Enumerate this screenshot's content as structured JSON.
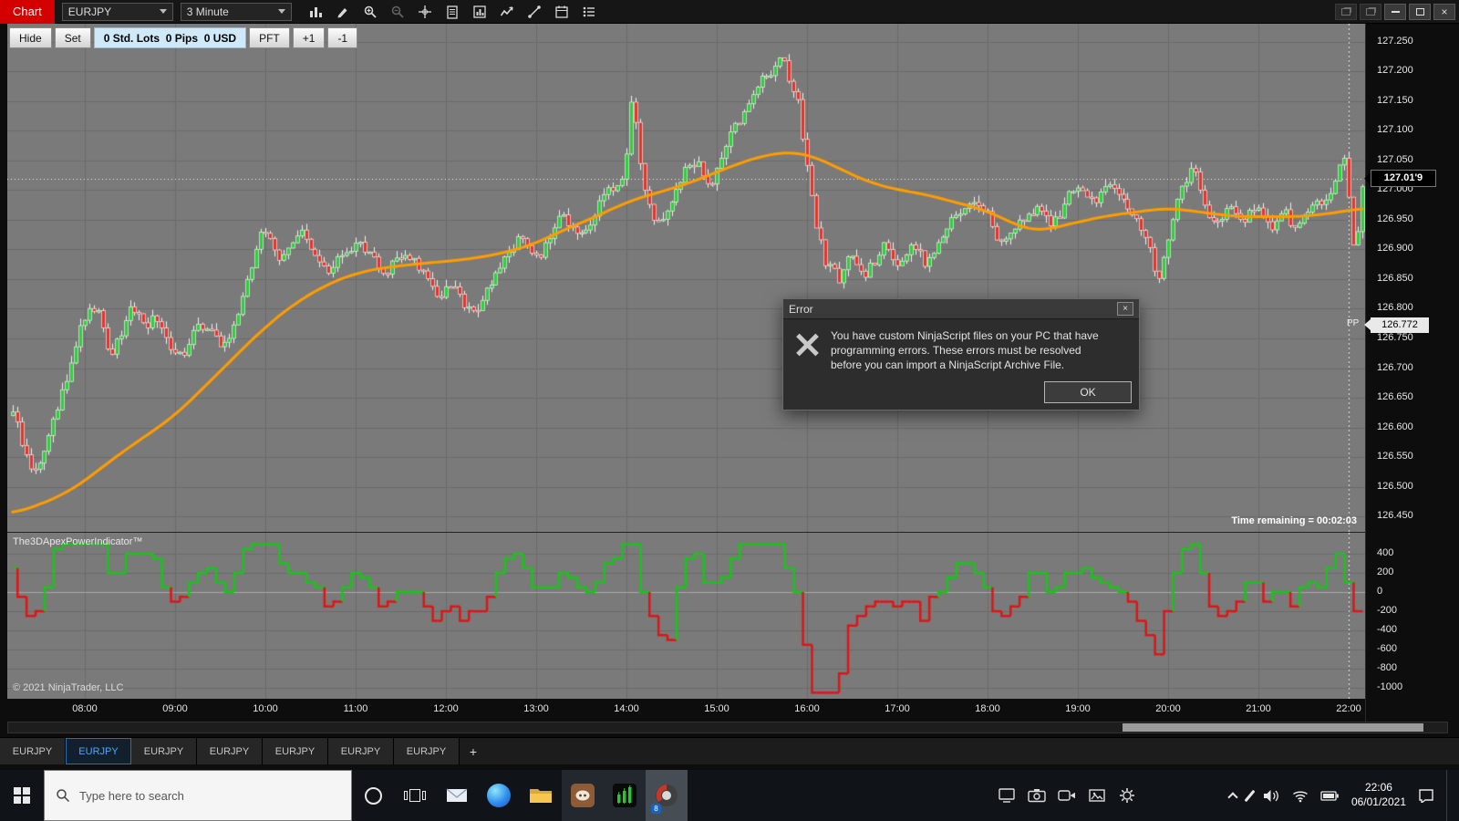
{
  "titlebar": {
    "app_label": "Chart",
    "instrument": "EURJPY",
    "period": "3 Minute",
    "toolbar_icons": [
      "chart-style-icon",
      "draw-tool-icon",
      "zoom-in-icon",
      "zoom-out-icon",
      "crosshair-icon",
      "report-icon",
      "chart-window-icon",
      "indicators-icon",
      "line-tool-icon",
      "data-series-icon",
      "properties-icon"
    ],
    "window_icons": [
      "workspace-icon",
      "workspace-icon",
      "minimize-icon",
      "maximize-icon",
      "close-icon"
    ]
  },
  "chart_trader": {
    "hide_label": "Hide",
    "set_label": "Set",
    "position_info": "0 Std. Lots  0 Pips  0 USD",
    "pft_label": "PFT",
    "plus_one_label": "+1",
    "minus_one_label": "-1"
  },
  "chart": {
    "current_price_tag": "127.01'9",
    "pivot_tag": "126.772",
    "pivot_label": "PP",
    "time_remaining": "Time remaining = 00:02:03",
    "copyright": "© 2021 NinjaTrader, LLC",
    "indicator_title": "The3DApexPowerIndicator™"
  },
  "error_dialog": {
    "title": "Error",
    "message": "You have custom NinjaScript files on your PC that have programming errors. These errors must be resolved before you can import a NinjaScript Archive File.",
    "ok_label": "OK"
  },
  "tabs": {
    "labels": [
      "EURJPY",
      "EURJPY",
      "EURJPY",
      "EURJPY",
      "EURJPY",
      "EURJPY",
      "EURJPY"
    ],
    "active_index": 1,
    "add_label": "+"
  },
  "taskbar": {
    "search_placeholder": "Type here to search",
    "clock_time": "22:06",
    "clock_date": "06/01/2021",
    "nt_badge": "8",
    "icons": [
      "start-button",
      "search-icon",
      "cortana-icon",
      "task-view-icon",
      "mail-icon",
      "edge-icon",
      "file-explorer-icon",
      "discord-icon",
      "chart-app-icon",
      "ninjatrader-icon",
      "screen-share-icon",
      "camera-icon",
      "video-camera-icon",
      "photos-icon",
      "gear-icon",
      "hidden-icons-chevron",
      "pen-icon",
      "volume-icon",
      "wifi-icon",
      "battery-icon",
      "clock",
      "notification-icon"
    ]
  },
  "chart_data": {
    "type": "candlestick",
    "instrument": "EURJPY",
    "interval_minutes": 3,
    "price_axis_labels": [
      "127.250",
      "127.200",
      "127.150",
      "127.100",
      "127.050",
      "127.000",
      "126.950",
      "126.900",
      "126.850",
      "126.800",
      "126.750",
      "126.700",
      "126.650",
      "126.600",
      "126.550",
      "126.500",
      "126.450"
    ],
    "indicator_axis_labels": [
      "400",
      "200",
      "0",
      "-200",
      "-400",
      "-600",
      "-800",
      "-1000"
    ],
    "time_axis_labels": [
      "08:00",
      "09:00",
      "10:00",
      "11:00",
      "12:00",
      "13:00",
      "14:00",
      "15:00",
      "16:00",
      "17:00",
      "18:00",
      "19:00",
      "20:00",
      "21:00",
      "22:00"
    ],
    "current_price_value": 127.019,
    "pivot_value": 126.772,
    "price_range": [
      126.45,
      127.25
    ],
    "indicator_range": [
      -1000,
      400
    ],
    "price_anchors": [
      [
        -48,
        126.63
      ],
      [
        -40,
        126.56
      ],
      [
        -34,
        126.52
      ],
      [
        -28,
        126.55
      ],
      [
        -20,
        126.62
      ],
      [
        -10,
        126.7
      ],
      [
        -4,
        126.76
      ],
      [
        2,
        126.79
      ],
      [
        8,
        126.81
      ],
      [
        16,
        126.72
      ],
      [
        24,
        126.76
      ],
      [
        31,
        126.81
      ],
      [
        40,
        126.77
      ],
      [
        47,
        126.79
      ],
      [
        56,
        126.74
      ],
      [
        65,
        126.72
      ],
      [
        74,
        126.77
      ],
      [
        83,
        126.76
      ],
      [
        92,
        126.73
      ],
      [
        100,
        126.78
      ],
      [
        108,
        126.85
      ],
      [
        114,
        126.9
      ],
      [
        119,
        126.94
      ],
      [
        125,
        126.9
      ],
      [
        131,
        126.88
      ],
      [
        138,
        126.91
      ],
      [
        144,
        126.93
      ],
      [
        152,
        126.89
      ],
      [
        162,
        126.86
      ],
      [
        170,
        126.89
      ],
      [
        183,
        126.91
      ],
      [
        192,
        126.88
      ],
      [
        201,
        126.86
      ],
      [
        208,
        126.89
      ],
      [
        216,
        126.89
      ],
      [
        226,
        126.86
      ],
      [
        235,
        126.81
      ],
      [
        241,
        126.84
      ],
      [
        247,
        126.83
      ],
      [
        253,
        126.8
      ],
      [
        259,
        126.79
      ],
      [
        266,
        126.83
      ],
      [
        274,
        126.86
      ],
      [
        281,
        126.89
      ],
      [
        289,
        126.92
      ],
      [
        295,
        126.9
      ],
      [
        301,
        126.88
      ],
      [
        308,
        126.92
      ],
      [
        316,
        126.96
      ],
      [
        324,
        126.94
      ],
      [
        332,
        126.92
      ],
      [
        338,
        126.95
      ],
      [
        344,
        126.99
      ],
      [
        350,
        127.0
      ],
      [
        356,
        127.01
      ],
      [
        360,
        127.06
      ],
      [
        363,
        127.14
      ],
      [
        366,
        127.12
      ],
      [
        368,
        127.06
      ],
      [
        372,
        127.0
      ],
      [
        377,
        126.95
      ],
      [
        382,
        126.95
      ],
      [
        386,
        126.96
      ],
      [
        392,
        127.0
      ],
      [
        398,
        127.03
      ],
      [
        403,
        127.04
      ],
      [
        407,
        127.05
      ],
      [
        412,
        127.02
      ],
      [
        416,
        127.01
      ],
      [
        420,
        127.03
      ],
      [
        424,
        127.06
      ],
      [
        428,
        127.09
      ],
      [
        433,
        127.11
      ],
      [
        437,
        127.12
      ],
      [
        442,
        127.15
      ],
      [
        447,
        127.18
      ],
      [
        451,
        127.2
      ],
      [
        456,
        127.19
      ],
      [
        459,
        127.21
      ],
      [
        462,
        127.23
      ],
      [
        465,
        127.21
      ],
      [
        468,
        127.18
      ],
      [
        471,
        127.16
      ],
      [
        474,
        127.15
      ],
      [
        477,
        127.09
      ],
      [
        480,
        127.04
      ],
      [
        483,
        126.99
      ],
      [
        486,
        126.93
      ],
      [
        489,
        126.91
      ],
      [
        492,
        126.88
      ],
      [
        496,
        126.87
      ],
      [
        501,
        126.85
      ],
      [
        506,
        126.88
      ],
      [
        510,
        126.89
      ],
      [
        515,
        126.87
      ],
      [
        519,
        126.86
      ],
      [
        525,
        126.88
      ],
      [
        531,
        126.91
      ],
      [
        536,
        126.89
      ],
      [
        540,
        126.88
      ],
      [
        545,
        126.89
      ],
      [
        550,
        126.91
      ],
      [
        555,
        126.89
      ],
      [
        559,
        126.87
      ],
      [
        564,
        126.9
      ],
      [
        568,
        126.92
      ],
      [
        574,
        126.94
      ],
      [
        580,
        126.96
      ],
      [
        585,
        126.97
      ],
      [
        589,
        126.98
      ],
      [
        594,
        126.97
      ],
      [
        598,
        126.97
      ],
      [
        601,
        126.95
      ],
      [
        604,
        126.93
      ],
      [
        607,
        126.91
      ],
      [
        610,
        126.91
      ],
      [
        613,
        126.92
      ],
      [
        616,
        126.93
      ],
      [
        620,
        126.94
      ],
      [
        625,
        126.95
      ],
      [
        629,
        126.96
      ],
      [
        634,
        126.97
      ],
      [
        639,
        126.95
      ],
      [
        643,
        126.94
      ],
      [
        648,
        126.96
      ],
      [
        653,
        126.99
      ],
      [
        658,
        127.0
      ],
      [
        662,
        127.01
      ],
      [
        666,
        126.99
      ],
      [
        671,
        126.98
      ],
      [
        675,
        127.0
      ],
      [
        680,
        127.02
      ],
      [
        684,
        127.0
      ],
      [
        689,
        126.99
      ],
      [
        694,
        126.97
      ],
      [
        698,
        126.96
      ],
      [
        702,
        126.93
      ],
      [
        707,
        126.91
      ],
      [
        710,
        126.88
      ],
      [
        713,
        126.85
      ],
      [
        716,
        126.87
      ],
      [
        719,
        126.91
      ],
      [
        723,
        126.95
      ],
      [
        728,
        127.0
      ],
      [
        733,
        127.02
      ],
      [
        737,
        127.04
      ],
      [
        740,
        127.01
      ],
      [
        743,
        126.98
      ],
      [
        747,
        126.96
      ],
      [
        752,
        126.94
      ],
      [
        757,
        126.96
      ],
      [
        761,
        126.97
      ],
      [
        766,
        126.95
      ],
      [
        770,
        126.95
      ],
      [
        775,
        126.96
      ],
      [
        780,
        126.97
      ],
      [
        785,
        126.95
      ],
      [
        789,
        126.94
      ],
      [
        794,
        126.95
      ],
      [
        798,
        126.96
      ],
      [
        803,
        126.94
      ],
      [
        807,
        126.94
      ],
      [
        812,
        126.96
      ],
      [
        816,
        126.97
      ],
      [
        821,
        126.98
      ],
      [
        825,
        126.99
      ],
      [
        828,
        127.0
      ],
      [
        831,
        127.02
      ],
      [
        834,
        127.04
      ],
      [
        837,
        127.06
      ],
      [
        839,
        127.03
      ],
      [
        841,
        126.96
      ],
      [
        843,
        126.91
      ],
      [
        845,
        126.89
      ],
      [
        847,
        126.96
      ],
      [
        849,
        127.01
      ]
    ],
    "ma_anchors": [
      [
        -48,
        126.455
      ],
      [
        -30,
        126.47
      ],
      [
        -12,
        126.49
      ],
      [
        0,
        126.51
      ],
      [
        20,
        126.55
      ],
      [
        40,
        126.585
      ],
      [
        60,
        126.62
      ],
      [
        80,
        126.67
      ],
      [
        100,
        126.72
      ],
      [
        120,
        126.77
      ],
      [
        140,
        126.81
      ],
      [
        160,
        126.84
      ],
      [
        180,
        126.86
      ],
      [
        200,
        126.87
      ],
      [
        220,
        126.875
      ],
      [
        240,
        126.88
      ],
      [
        260,
        126.885
      ],
      [
        280,
        126.895
      ],
      [
        300,
        126.91
      ],
      [
        320,
        126.935
      ],
      [
        340,
        126.955
      ],
      [
        360,
        126.98
      ],
      [
        380,
        126.995
      ],
      [
        400,
        127.01
      ],
      [
        420,
        127.03
      ],
      [
        440,
        127.05
      ],
      [
        455,
        127.06
      ],
      [
        470,
        127.065
      ],
      [
        480,
        127.06
      ],
      [
        495,
        127.045
      ],
      [
        510,
        127.025
      ],
      [
        525,
        127.01
      ],
      [
        540,
        127.0
      ],
      [
        555,
        126.995
      ],
      [
        570,
        126.985
      ],
      [
        585,
        126.975
      ],
      [
        600,
        126.965
      ],
      [
        612,
        126.95
      ],
      [
        624,
        126.935
      ],
      [
        636,
        126.93
      ],
      [
        648,
        126.94
      ],
      [
        660,
        126.945
      ],
      [
        675,
        126.955
      ],
      [
        690,
        126.96
      ],
      [
        705,
        126.965
      ],
      [
        720,
        126.97
      ],
      [
        735,
        126.965
      ],
      [
        750,
        126.96
      ],
      [
        765,
        126.955
      ],
      [
        780,
        126.955
      ],
      [
        795,
        126.955
      ],
      [
        810,
        126.955
      ],
      [
        825,
        126.96
      ],
      [
        840,
        126.965
      ],
      [
        850,
        126.97
      ]
    ],
    "colors": {
      "panel_bg": "#7a7a7a",
      "grid": "#6b6b6b",
      "zero_line": "#a8a8a8",
      "up": "#2fcf3a",
      "down": "#e5342a",
      "wick": "#f0f0f0",
      "ma": "#ff9d00",
      "ind_up": "#17c617",
      "ind_down": "#e01414",
      "session_line": "#e8e8e8"
    }
  }
}
